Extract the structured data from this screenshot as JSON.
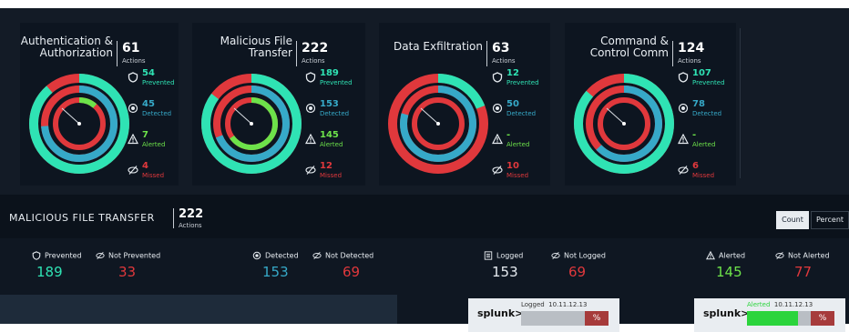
{
  "colors": {
    "prevented": "#2fe3b4",
    "detected": "#36a9c8",
    "alerted": "#6de24a",
    "missed": "#e0383c",
    "panel": "#0d1520"
  },
  "cards": [
    {
      "title_line1": "Authentication &",
      "title_line2": "Authorization",
      "count": "61",
      "actions_label": "Actions",
      "stats": {
        "prevented": {
          "value": "54",
          "label": "Prevented",
          "icon": "shield-icon"
        },
        "detected": {
          "value": "45",
          "label": "Detected",
          "icon": "radar-icon"
        },
        "alerted": {
          "value": "7",
          "label": "Alerted",
          "icon": "warning-icon"
        },
        "missed": {
          "value": "4",
          "label": "Missed",
          "icon": "eye-off-icon"
        }
      }
    },
    {
      "title_line1": "Malicious File",
      "title_line2": "Transfer",
      "count": "222",
      "actions_label": "Actions",
      "stats": {
        "prevented": {
          "value": "189",
          "label": "Prevented",
          "icon": "shield-icon"
        },
        "detected": {
          "value": "153",
          "label": "Detected",
          "icon": "radar-icon"
        },
        "alerted": {
          "value": "145",
          "label": "Alerted",
          "icon": "warning-icon"
        },
        "missed": {
          "value": "12",
          "label": "Missed",
          "icon": "eye-off-icon"
        }
      }
    },
    {
      "title_line1": "Data Exfiltration",
      "title_line2": "",
      "count": "63",
      "actions_label": "Actions",
      "stats": {
        "prevented": {
          "value": "12",
          "label": "Prevented",
          "icon": "shield-icon"
        },
        "detected": {
          "value": "50",
          "label": "Detected",
          "icon": "radar-icon"
        },
        "alerted": {
          "value": "-",
          "label": "Alerted",
          "icon": "warning-icon"
        },
        "missed": {
          "value": "10",
          "label": "Missed",
          "icon": "eye-off-icon"
        }
      }
    },
    {
      "title_line1": "Command &",
      "title_line2": "Control Comm",
      "count": "124",
      "actions_label": "Actions",
      "stats": {
        "prevented": {
          "value": "107",
          "label": "Prevented",
          "icon": "shield-icon"
        },
        "detected": {
          "value": "78",
          "label": "Detected",
          "icon": "radar-icon"
        },
        "alerted": {
          "value": "-",
          "label": "Alerted",
          "icon": "warning-icon"
        },
        "missed": {
          "value": "6",
          "label": "Missed",
          "icon": "eye-off-icon"
        }
      }
    }
  ],
  "detail": {
    "title": "MALICIOUS FILE TRANSFER",
    "count": "222",
    "actions_label": "Actions",
    "toggle": {
      "count_label": "Count",
      "percent_label": "Percent",
      "selected": "Count"
    },
    "metrics": {
      "prevented": {
        "label": "Prevented",
        "value": "189",
        "icon": "shield-icon"
      },
      "not_prevented": {
        "label": "Not Prevented",
        "value": "33",
        "icon": "eye-off-icon"
      },
      "detected": {
        "label": "Detected",
        "value": "153",
        "icon": "radar-icon"
      },
      "not_detected": {
        "label": "Not Detected",
        "value": "69",
        "icon": "eye-off-icon"
      },
      "logged": {
        "label": "Logged",
        "value": "153",
        "icon": "log-icon"
      },
      "not_logged": {
        "label": "Not Logged",
        "value": "69",
        "icon": "eye-off-icon"
      },
      "alerted": {
        "label": "Alerted",
        "value": "145",
        "icon": "warning-icon"
      },
      "not_alerted": {
        "label": "Not Alerted",
        "value": "77",
        "icon": "eye-off-icon"
      }
    },
    "splunk": [
      {
        "logo": "splunk>",
        "status": "Logged",
        "ip": "10.11.12.13",
        "pct": "%",
        "fill_color": "#b9bec4",
        "fill_fraction": 0.7
      },
      {
        "logo": "splunk>",
        "status": "Alerted",
        "ip": "10.11.12.13",
        "pct": "%",
        "fill_color": "#2bd43c",
        "fill_fraction": 0.8
      }
    ]
  }
}
